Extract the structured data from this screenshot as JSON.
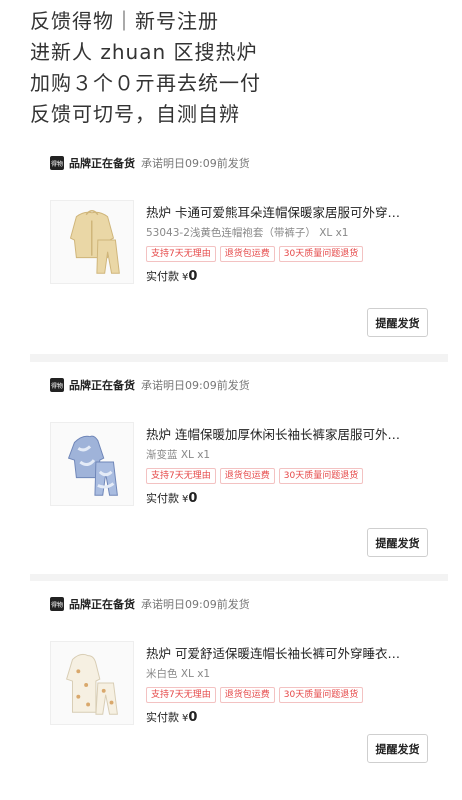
{
  "caption": {
    "lines": [
      "反馈得物｜新号注册",
      "进新人 zhuan 区搜热炉",
      "加购３个０亓再去统一付",
      "反馈可切号，自测自辨"
    ]
  },
  "orders": [
    {
      "shop": {
        "logo_text": "得物",
        "name": "品牌正在备货",
        "promise": "承诺明日09:09前发货"
      },
      "product": {
        "title": "热炉 卡通可爱熊耳朵连帽保暖家居服可外穿…",
        "variant": "53043-2浅黄色连帽袍套（带裤子） XL x1",
        "image": "cream-fleece-robe-set"
      },
      "tags": [
        "支持7天无理由",
        "退货包运费",
        "30天质量问题退货"
      ],
      "paid": {
        "label": "实付款",
        "currency": "¥",
        "amount": "0"
      },
      "action": "提醒发货"
    },
    {
      "shop": {
        "logo_text": "得物",
        "name": "品牌正在备货",
        "promise": "承诺明日09:09前发货"
      },
      "product": {
        "title": "热炉 连帽保暖加厚休闲长袖长裤家居服可外…",
        "variant": "渐变蓝 XL x1",
        "image": "blue-tie-dye-hoodie-set"
      },
      "tags": [
        "支持7天无理由",
        "退货包运费",
        "30天质量问题退货"
      ],
      "paid": {
        "label": "实付款",
        "currency": "¥",
        "amount": "0"
      },
      "action": "提醒发货"
    },
    {
      "shop": {
        "logo_text": "得物",
        "name": "品牌正在备货",
        "promise": "承诺明日09:09前发货"
      },
      "product": {
        "title": "热炉 可爱舒适保暖连帽长袖长裤可外穿睡衣…",
        "variant": "米白色 XL x1",
        "image": "white-print-pajama-set"
      },
      "tags": [
        "支持7天无理由",
        "退货包运费",
        "30天质量问题退货"
      ],
      "paid": {
        "label": "实付款",
        "currency": "¥",
        "amount": "0"
      },
      "action": "提醒发货"
    }
  ],
  "colors": {
    "tag_red": "#e54848",
    "tag_border": "#f3c2c2",
    "separator": "#f3f3f3",
    "logo_bg": "#222222"
  }
}
